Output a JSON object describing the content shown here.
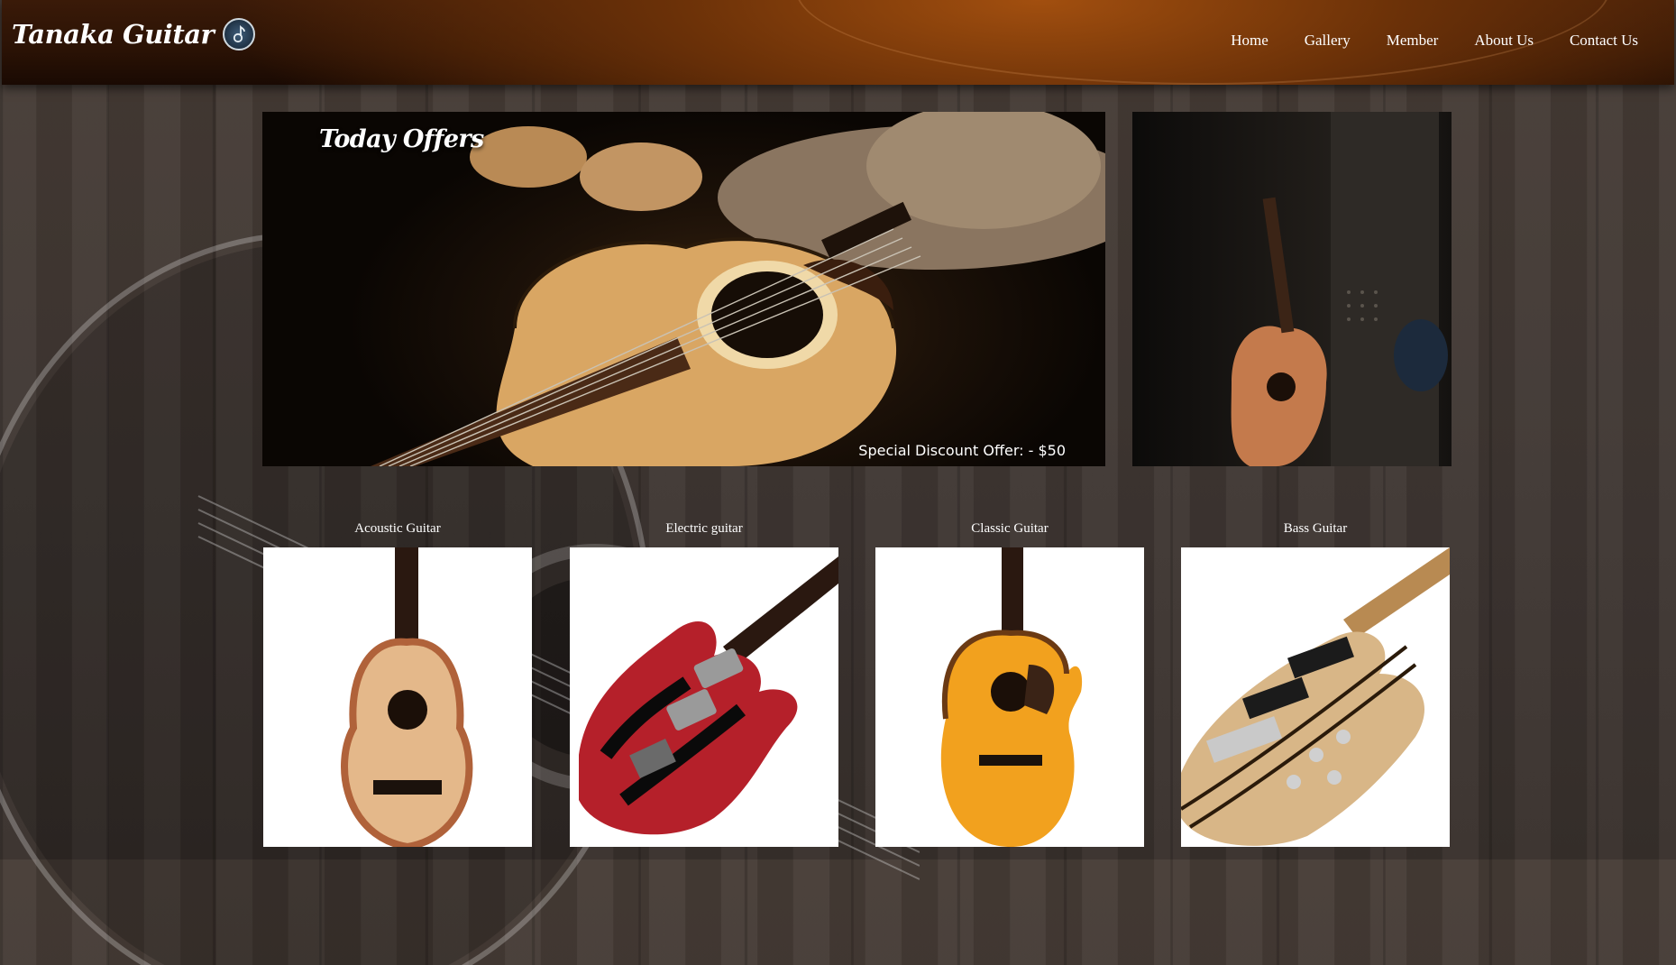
{
  "brand": {
    "title": "Tanaka Guitar",
    "logo_icon": "guitar-logo-icon"
  },
  "nav": {
    "items": [
      {
        "label": "Home"
      },
      {
        "label": "Gallery"
      },
      {
        "label": "Member"
      },
      {
        "label": "About Us"
      },
      {
        "label": "Contact Us"
      }
    ]
  },
  "hero": {
    "title": "Today Offers",
    "offer": "Special Discount Offer: - $50"
  },
  "categories": [
    {
      "label": "Acoustic Guitar"
    },
    {
      "label": "Electric guitar"
    },
    {
      "label": "Classic Guitar"
    },
    {
      "label": "Bass Guitar"
    }
  ],
  "colors": {
    "header": "#6b3108",
    "background": "#3e3632",
    "text": "#ffffff"
  }
}
